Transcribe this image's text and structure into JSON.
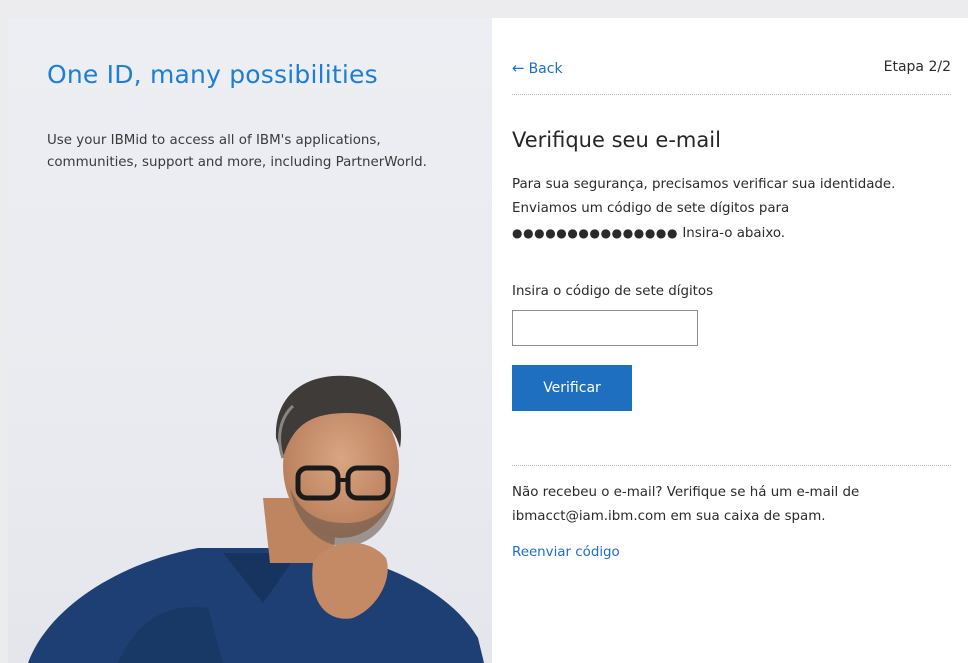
{
  "left": {
    "title": "One ID, many possibilities",
    "subtitle": "Use your IBMid to access all of IBM's applications, communities, support and more, including PartnerWorld."
  },
  "header": {
    "back_label": "Back",
    "back_icon": "arrow-left-icon",
    "step": "Etapa 2/2"
  },
  "verify": {
    "title": "Verifique seu e-mail",
    "line1": "Para sua segurança, precisamos verificar sua identidade.",
    "line2": "Enviamos um código de sete dígitos para",
    "masked_email": "●●●●●●●●●●●●●●●",
    "line3": "Insira-o abaixo.",
    "field_label": "Insira o código de sete dígitos",
    "input_value": "",
    "button_label": "Verificar"
  },
  "footer": {
    "spam_note": "Não recebeu o e-mail? Verifique se há um e-mail de ibmacct@iam.ibm.com em sua caixa de spam.",
    "resend_label": "Reenviar código"
  },
  "colors": {
    "accent": "#1d7ed8",
    "button": "#1f6fc0",
    "link": "#1d6fc5"
  }
}
